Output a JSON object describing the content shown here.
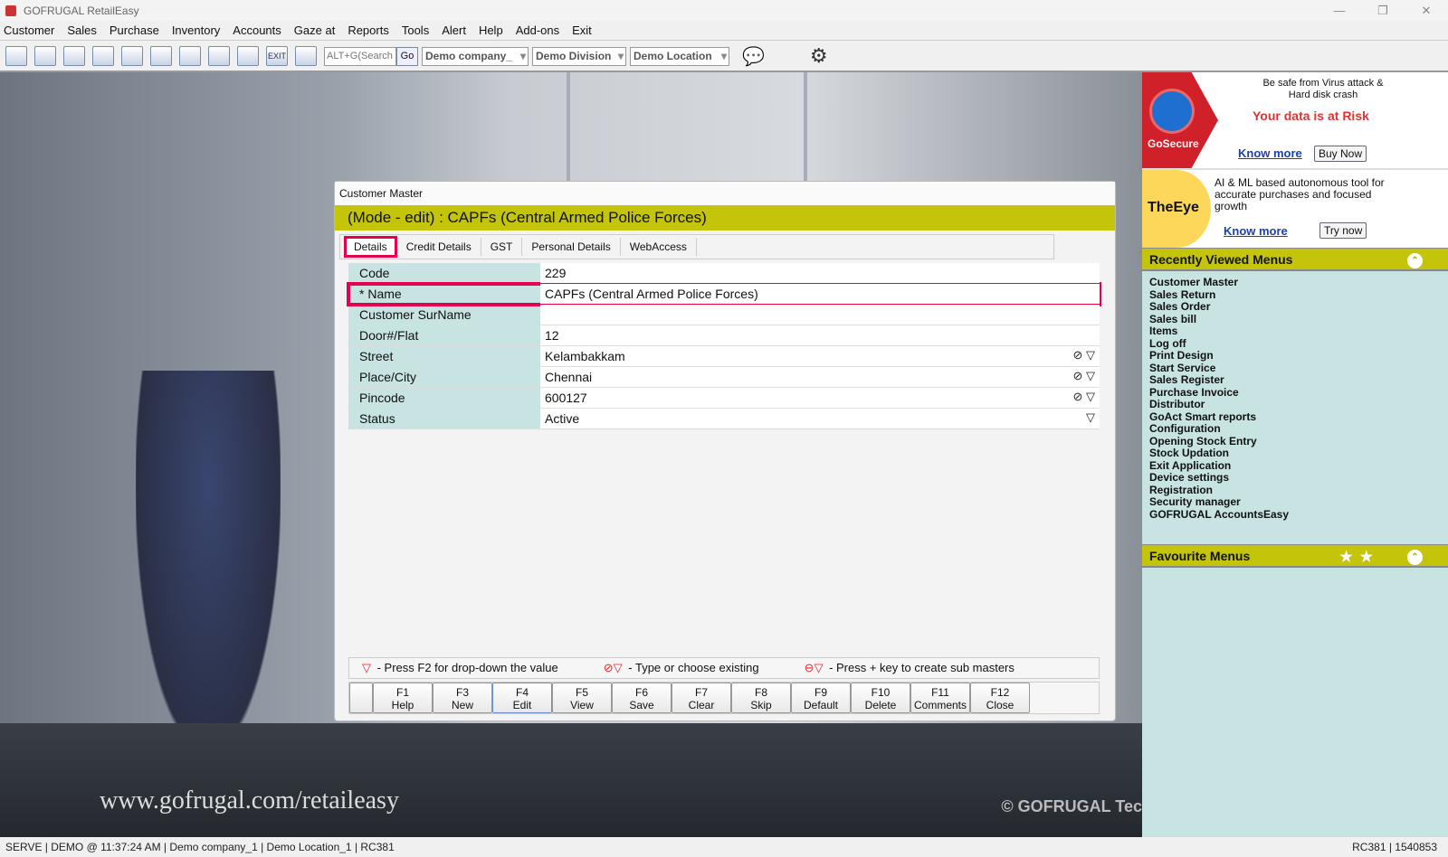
{
  "window": {
    "title": "GOFRUGAL RetailEasy",
    "min": "—",
    "max": "❐",
    "close": "✕"
  },
  "menu": [
    "Customer",
    "Sales",
    "Purchase",
    "Inventory",
    "Accounts",
    "Gaze at",
    "Reports",
    "Tools",
    "Alert",
    "Help",
    "Add-ons",
    "Exit"
  ],
  "toolbar": {
    "icons": [
      "ledger-icon",
      "cart-doc-icon",
      "report-icon",
      "keyboard-icon",
      "print-icon",
      "doc-icon",
      "cart-icon",
      "folder-icon",
      "chart-icon",
      "exit-icon",
      "graph-icon"
    ],
    "exit_label": "EXIT",
    "search_placeholder": "ALT+G(Search",
    "go": "Go",
    "company": "Demo company_",
    "division": "Demo Division",
    "location": "Demo Location"
  },
  "background": {
    "watermark": "www.gofrugal.com/retaileasy",
    "copyright": "© GOFRUGAL Tec"
  },
  "ads": {
    "gosecure": {
      "brand": "GoSecure",
      "line1": "Be safe from Virus attack &",
      "line2": "Hard disk crash",
      "headline": "Your data is at Risk",
      "know_more": "Know more",
      "buy": "Buy Now"
    },
    "theeye": {
      "brand": "TheEye",
      "text": "AI & ML based autonomous tool for accurate purchases and focused growth",
      "know_more": "Know more",
      "try": "Try now"
    }
  },
  "recent": {
    "title": "Recently Viewed Menus",
    "items": [
      "Customer Master",
      "Sales Return",
      "Sales Order",
      "Sales bill",
      "Items",
      "Log off",
      "Print Design",
      "Start Service",
      "Sales Register",
      "Purchase Invoice",
      "Distributor",
      "GoAct Smart reports",
      "Configuration",
      "Opening Stock Entry",
      "Stock Updation",
      "Exit Application",
      "Device settings",
      "Registration",
      "Security manager",
      "GOFRUGAL AccountsEasy"
    ]
  },
  "favourite": {
    "title": "Favourite Menus"
  },
  "dialog": {
    "title": "Customer Master",
    "mode": "(Mode - edit)  :  CAPFs (Central Armed Police Forces)",
    "tabs": [
      "Details",
      "Credit Details",
      "GST",
      "Personal Details",
      "WebAccess"
    ],
    "fields": [
      {
        "label": "Code",
        "value": "229",
        "icons": ""
      },
      {
        "label": "* Name",
        "value": "CAPFs (Central Armed Police Forces)",
        "icons": ""
      },
      {
        "label": "Customer SurName",
        "value": "",
        "icons": ""
      },
      {
        "label": "Door#/Flat",
        "value": "12",
        "icons": ""
      },
      {
        "label": "Street",
        "value": "Kelambakkam",
        "icons": "⊘ ▽"
      },
      {
        "label": "Place/City",
        "value": "Chennai",
        "icons": "⊘ ▽"
      },
      {
        "label": "Pincode",
        "value": "600127",
        "icons": "⊘ ▽"
      },
      {
        "label": "Status",
        "value": "Active",
        "icons": "▽"
      }
    ],
    "legend": [
      {
        "sym": "▽",
        "text": " - Press F2 for drop-down the value"
      },
      {
        "sym": "⊘▽",
        "text": " - Type or choose existing"
      },
      {
        "sym": "⊖▽",
        "text": " - Press + key to create sub masters"
      }
    ],
    "fkeys": [
      {
        "k": "F1",
        "l": "Help"
      },
      {
        "k": "F3",
        "l": "New"
      },
      {
        "k": "F4",
        "l": "Edit"
      },
      {
        "k": "F5",
        "l": "View"
      },
      {
        "k": "F6",
        "l": "Save"
      },
      {
        "k": "F7",
        "l": "Clear"
      },
      {
        "k": "F8",
        "l": "Skip"
      },
      {
        "k": "F9",
        "l": "Default"
      },
      {
        "k": "F10",
        "l": "Delete"
      },
      {
        "k": "F11",
        "l": "Comments"
      },
      {
        "k": "F12",
        "l": "Close"
      }
    ]
  },
  "status": {
    "left": "SERVE | DEMO  @ 11:37:24 AM   | Demo company_1   | Demo Location_1 | RC381",
    "right": "RC381    |    1540853"
  }
}
